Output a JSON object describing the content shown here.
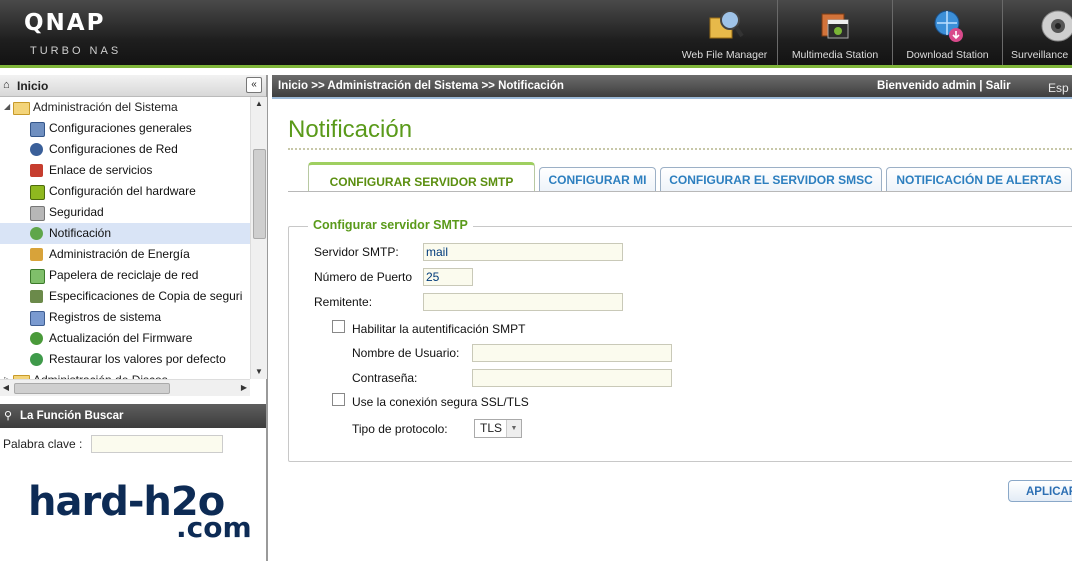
{
  "header": {
    "logo": "QNAP",
    "logo_sub": "Turbo NAS",
    "apps": [
      {
        "label": "Web File Manager",
        "icon": "web-file-manager-icon"
      },
      {
        "label": "Multimedia Station",
        "icon": "multimedia-station-icon"
      },
      {
        "label": "Download Station",
        "icon": "download-station-icon"
      },
      {
        "label": "Surveillance",
        "icon": "surveillance-icon"
      }
    ]
  },
  "sidebar": {
    "title": "Inicio",
    "collapse": "«",
    "group": "Administración del Sistema",
    "items": [
      {
        "label": "Configuraciones generales"
      },
      {
        "label": "Configuraciones de Red"
      },
      {
        "label": "Enlace de servicios"
      },
      {
        "label": "Configuración del hardware"
      },
      {
        "label": "Seguridad"
      },
      {
        "label": "Notificación"
      },
      {
        "label": "Administración de Energía"
      },
      {
        "label": "Papelera de reciclaje de red"
      },
      {
        "label": "Especificaciones de Copia de seguri"
      },
      {
        "label": "Registros de sistema"
      },
      {
        "label": "Actualización del Firmware"
      },
      {
        "label": "Restaurar los valores por defecto"
      }
    ],
    "next_group": "Administración de Discos",
    "selected_item": "Notificación"
  },
  "search": {
    "title": "La Función Buscar",
    "keyword_label": "Palabra clave :",
    "keyword_value": ""
  },
  "watermark": {
    "line1": "hard-h2o",
    "line2": ".com"
  },
  "topnav": {
    "breadcrumb": "Inicio >> Administración del Sistema >> Notificación",
    "welcome": "Bienvenido admin | Salir",
    "language": "Esp"
  },
  "main": {
    "title": "Notificación",
    "tabs": [
      {
        "label": "CONFIGURAR SERVIDOR SMTP"
      },
      {
        "label": "CONFIGURAR MI"
      },
      {
        "label": "CONFIGURAR EL SERVIDOR SMSC"
      },
      {
        "label": "NOTIFICACIÓN DE ALERTAS"
      }
    ],
    "active_tab": "CONFIGURAR SERVIDOR SMTP",
    "section_title": "Configurar servidor SMTP",
    "smtp_server_label": "Servidor SMTP:",
    "smtp_server_value": "mail",
    "port_label": "Número de Puerto",
    "port_value": "25",
    "sender_label": "Remitente:",
    "sender_value": "",
    "auth_label": "Habilitar la autentificación SMPT",
    "auth_checked": false,
    "username_label": "Nombre de Usuario:",
    "username_value": "",
    "password_label": "Contraseña:",
    "password_value": "",
    "ssl_label": "Use la conexión segura SSL/TLS",
    "ssl_checked": false,
    "protocol_label": "Tipo de protocolo:",
    "protocol_value": "TLS",
    "apply_label": "APLICAR"
  },
  "colors": {
    "accent_green": "#5a9a1a",
    "tab_blue": "#2d7fbf",
    "header_dark": "#1e1e1e",
    "selected_row": "#d9e4f6"
  }
}
